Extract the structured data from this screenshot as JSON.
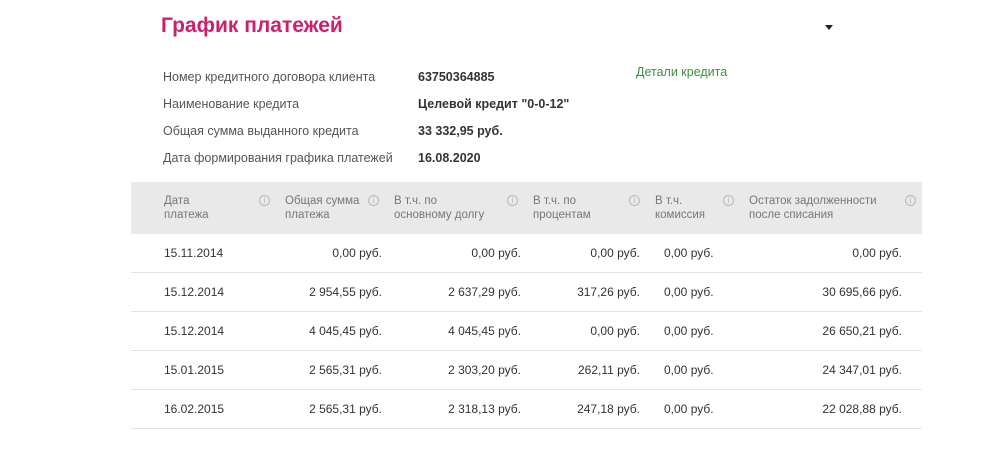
{
  "title": "График платежей",
  "toggle_icon": "caret-down-icon",
  "info": [
    {
      "label": "Номер кредитного договора клиента",
      "value": "63750364885"
    },
    {
      "label": "Наименование кредита",
      "value": "Целевой кредит \"0-0-12\""
    },
    {
      "label": "Общая сумма выданного кредита",
      "value": "33 332,95 руб."
    },
    {
      "label": "Дата формирования графика платежей",
      "value": "16.08.2020"
    }
  ],
  "details_link": "Детали кредита",
  "colors": {
    "title": "#cc1f6e",
    "link": "#3c8f3c",
    "header_bg": "#e9e9e9"
  },
  "table": {
    "headers": [
      "Дата\nплатежа",
      "Общая сумма\nплатежа",
      "В т.ч. по\nосновному долгу",
      "В т.ч. по\nпроцентам",
      "В т.ч.\nкомиссия",
      "Остаток задолженности\nпосле списания"
    ],
    "rows": [
      [
        "15.11.2014",
        "0,00 руб.",
        "0,00 руб.",
        "0,00 руб.",
        "0,00 руб.",
        "0,00 руб."
      ],
      [
        "15.12.2014",
        "2 954,55 руб.",
        "2 637,29 руб.",
        "317,26 руб.",
        "0,00 руб.",
        "30 695,66 руб."
      ],
      [
        "15.12.2014",
        "4 045,45 руб.",
        "4 045,45 руб.",
        "0,00 руб.",
        "0,00 руб.",
        "26 650,21 руб."
      ],
      [
        "15.01.2015",
        "2 565,31 руб.",
        "2 303,20 руб.",
        "262,11 руб.",
        "0,00 руб.",
        "24 347,01 руб."
      ],
      [
        "16.02.2015",
        "2 565,31 руб.",
        "2 318,13 руб.",
        "247,18 руб.",
        "0,00 руб.",
        "22 028,88 руб."
      ]
    ]
  }
}
